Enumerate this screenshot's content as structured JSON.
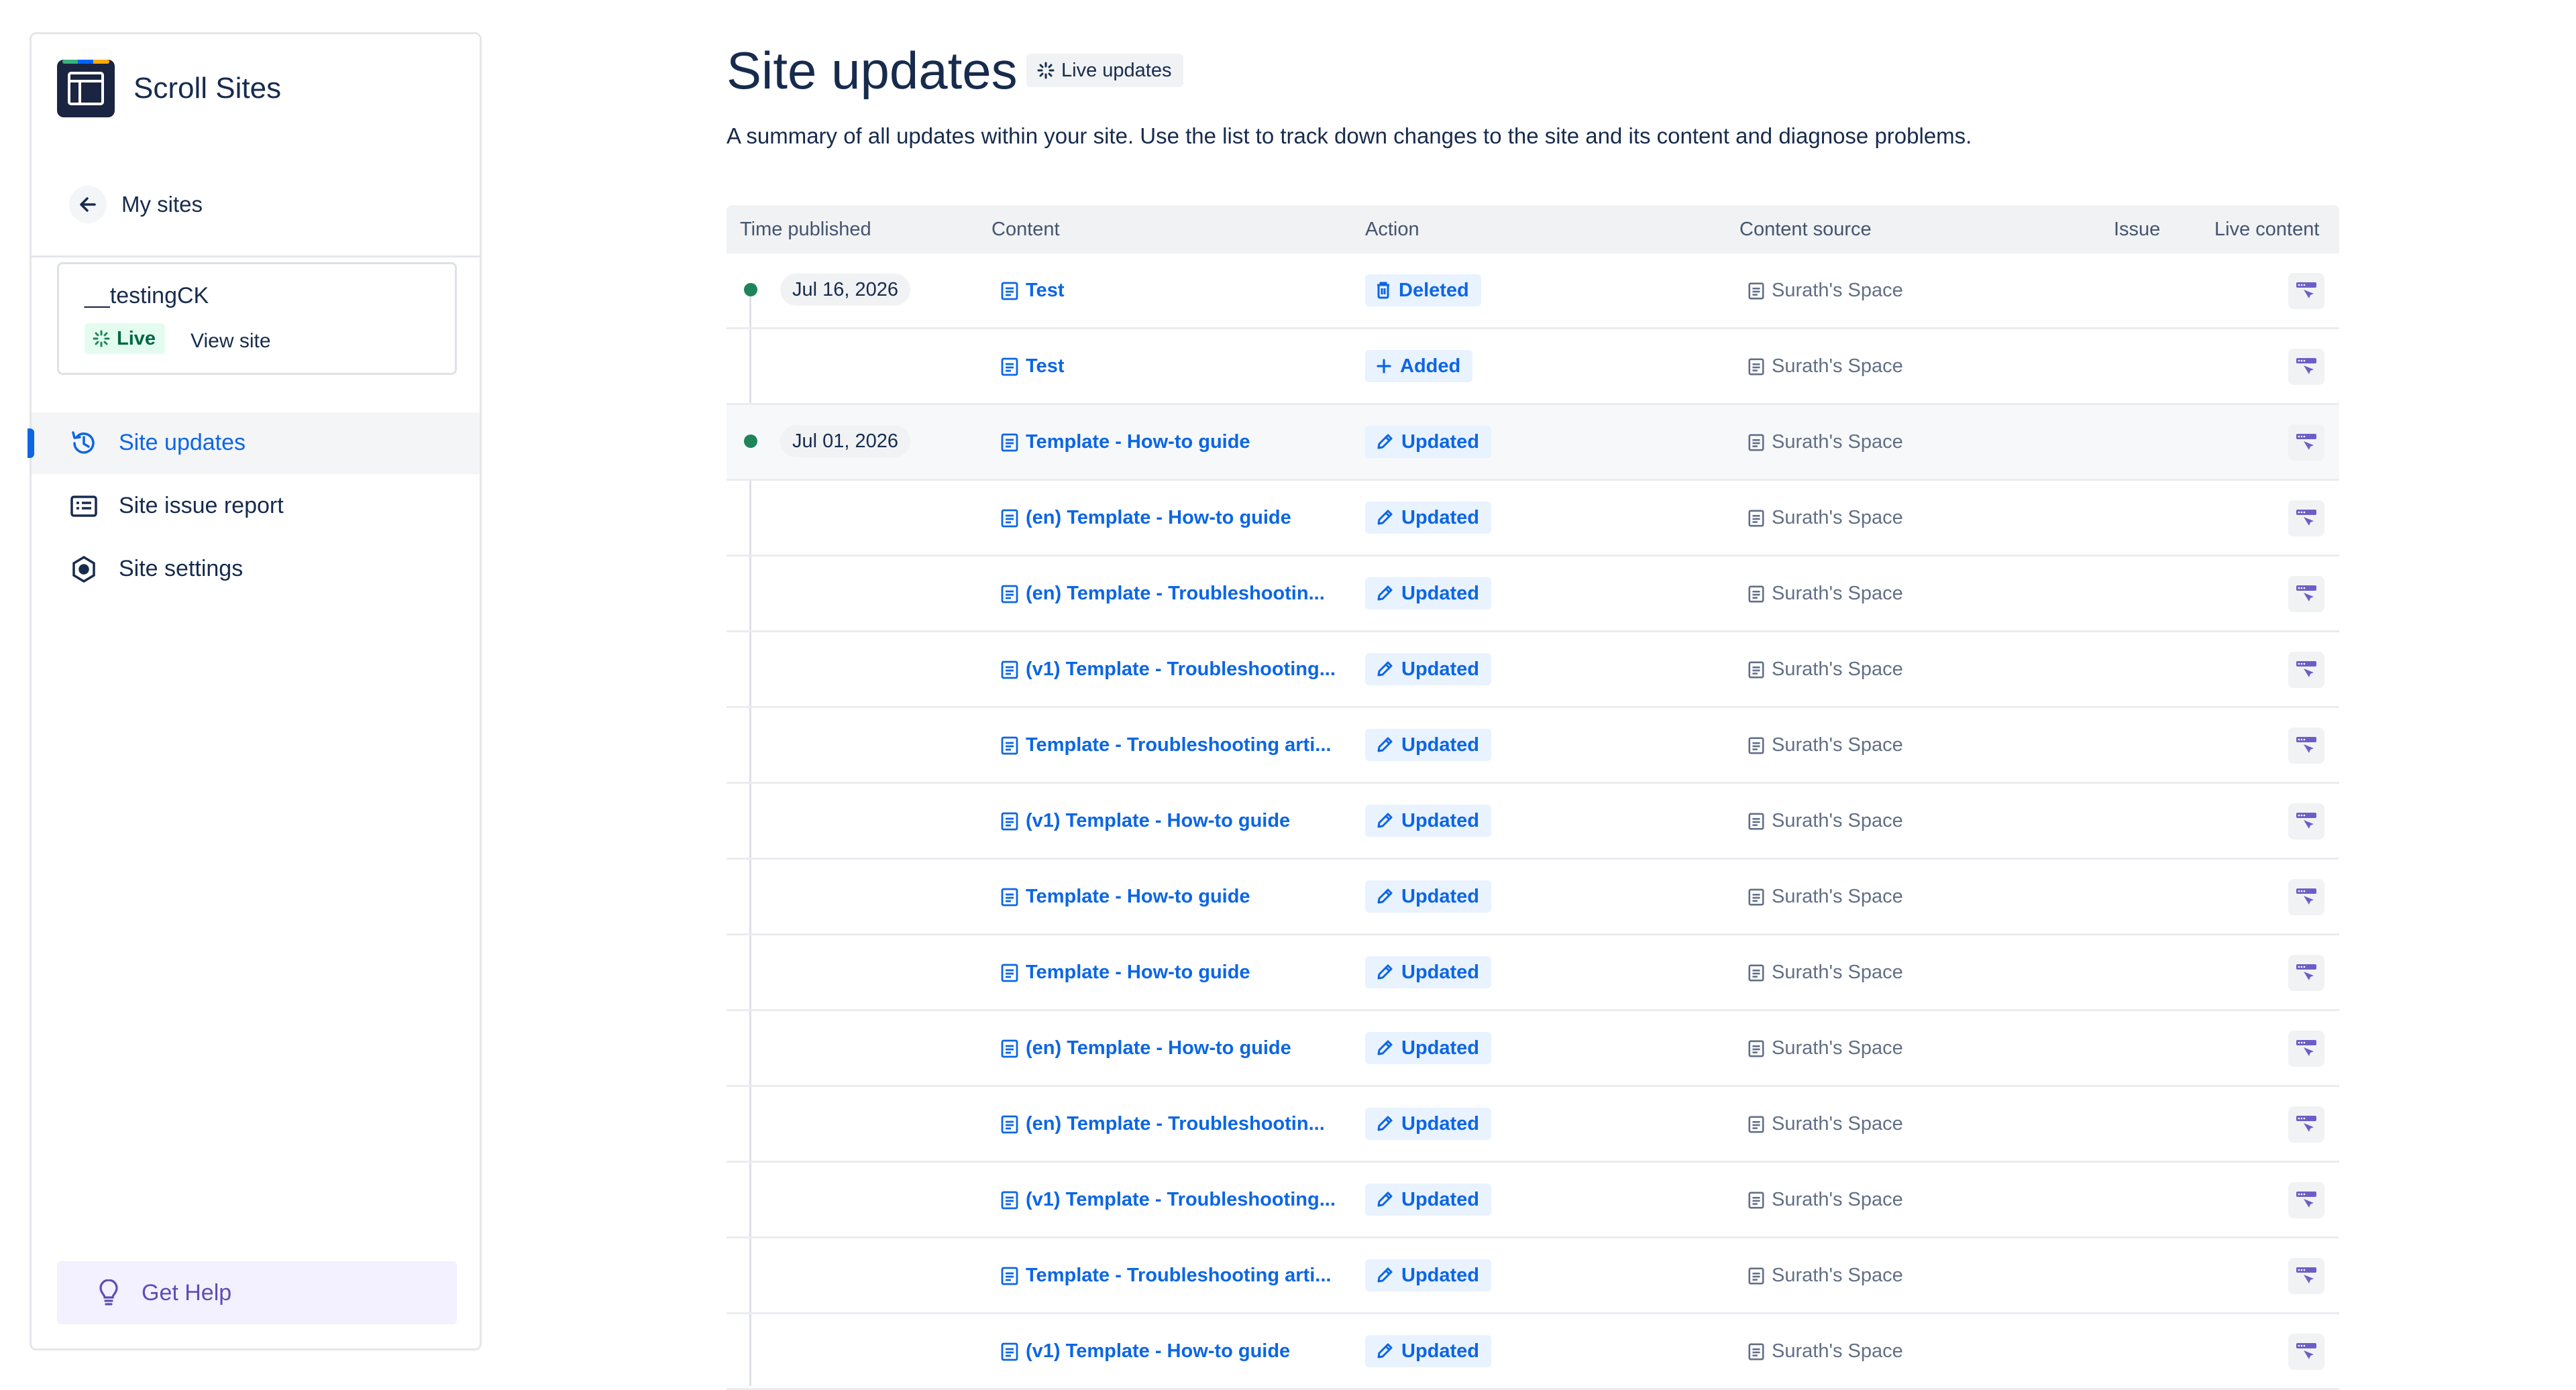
{
  "sidebar": {
    "brand_title": "Scroll Sites",
    "back_label": "My sites",
    "site": {
      "name": "__testingCK",
      "status": "Live",
      "view_site": "View site"
    },
    "nav": [
      {
        "label": "Site updates",
        "icon": "history-icon",
        "active": true
      },
      {
        "label": "Site issue report",
        "icon": "report-icon",
        "active": false
      },
      {
        "label": "Site settings",
        "icon": "settings-icon",
        "active": false
      }
    ],
    "help_label": "Get Help"
  },
  "main": {
    "title": "Site updates",
    "live_badge": "Live updates",
    "subtitle": "A summary of all updates within your site. Use the list to track down changes to the site and its content and diagnose problems.",
    "columns": [
      "Time published",
      "Content",
      "Action",
      "Content source",
      "Issue",
      "Live content"
    ],
    "rows": [
      {
        "date": "Jul 16, 2026",
        "content": "Test",
        "action": "Deleted",
        "action_icon": "trash-icon",
        "source": "Surath's Space"
      },
      {
        "date": "",
        "content": "Test",
        "action": "Added",
        "action_icon": "plus-icon",
        "source": "Surath's Space"
      },
      {
        "date": "Jul 01, 2026",
        "content": "Template - How-to guide",
        "action": "Updated",
        "action_icon": "pencil-icon",
        "source": "Surath's Space"
      },
      {
        "date": "",
        "content": "(en) Template - How-to guide",
        "action": "Updated",
        "action_icon": "pencil-icon",
        "source": "Surath's Space"
      },
      {
        "date": "",
        "content": "(en) Template - Troubleshootin...",
        "action": "Updated",
        "action_icon": "pencil-icon",
        "source": "Surath's Space"
      },
      {
        "date": "",
        "content": "(v1) Template - Troubleshooting...",
        "action": "Updated",
        "action_icon": "pencil-icon",
        "source": "Surath's Space"
      },
      {
        "date": "",
        "content": "Template - Troubleshooting arti...",
        "action": "Updated",
        "action_icon": "pencil-icon",
        "source": "Surath's Space"
      },
      {
        "date": "",
        "content": "(v1) Template - How-to guide",
        "action": "Updated",
        "action_icon": "pencil-icon",
        "source": "Surath's Space"
      },
      {
        "date": "",
        "content": "Template - How-to guide",
        "action": "Updated",
        "action_icon": "pencil-icon",
        "source": "Surath's Space"
      },
      {
        "date": "",
        "content": "Template - How-to guide",
        "action": "Updated",
        "action_icon": "pencil-icon",
        "source": "Surath's Space"
      },
      {
        "date": "",
        "content": "(en) Template - How-to guide",
        "action": "Updated",
        "action_icon": "pencil-icon",
        "source": "Surath's Space"
      },
      {
        "date": "",
        "content": "(en) Template - Troubleshootin...",
        "action": "Updated",
        "action_icon": "pencil-icon",
        "source": "Surath's Space"
      },
      {
        "date": "",
        "content": "(v1) Template - Troubleshooting...",
        "action": "Updated",
        "action_icon": "pencil-icon",
        "source": "Surath's Space"
      },
      {
        "date": "",
        "content": "Template - Troubleshooting arti...",
        "action": "Updated",
        "action_icon": "pencil-icon",
        "source": "Surath's Space"
      },
      {
        "date": "",
        "content": "(v1) Template - How-to guide",
        "action": "Updated",
        "action_icon": "pencil-icon",
        "source": "Surath's Space"
      }
    ]
  },
  "colors": {
    "accent": "#0c66e4",
    "live_green": "#1f845a",
    "help_purple": "#5e4db2",
    "live_content_icon": "#6e5dc6"
  }
}
